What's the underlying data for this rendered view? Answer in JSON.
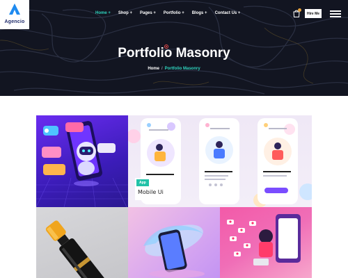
{
  "logo": {
    "name": "Agencio"
  },
  "nav": {
    "items": [
      {
        "label": "Home +",
        "active": true
      },
      {
        "label": "Shop +",
        "active": false
      },
      {
        "label": "Pages +",
        "active": false
      },
      {
        "label": "Portfolio +",
        "active": false
      },
      {
        "label": "Blogs +",
        "active": false
      },
      {
        "label": "Contact Us +",
        "active": false
      }
    ],
    "cart_icon": "bag-icon",
    "hire_label": "Hire Me",
    "menu_icon": "hamburger-icon"
  },
  "hero": {
    "title": "Portfolio Masonry",
    "breadcrumb": {
      "home": "Home",
      "separator": "/",
      "current": "Portfolio Masonry"
    }
  },
  "portfolio": {
    "featured": {
      "tag": "App",
      "title": "Mobile Ui"
    },
    "tiles": [
      {
        "image": "chatbot-robot-illustration"
      },
      {
        "image": "mobile-app-screens-illustration"
      },
      {
        "image": "cosmetic-bottle-photo"
      },
      {
        "image": "phone-splash-3d-render"
      },
      {
        "image": "social-media-likes-illustration"
      }
    ]
  },
  "colors": {
    "accent": "#2fd6c0",
    "hero_bg": "#121521",
    "tag_bg": "#22c2a8"
  }
}
